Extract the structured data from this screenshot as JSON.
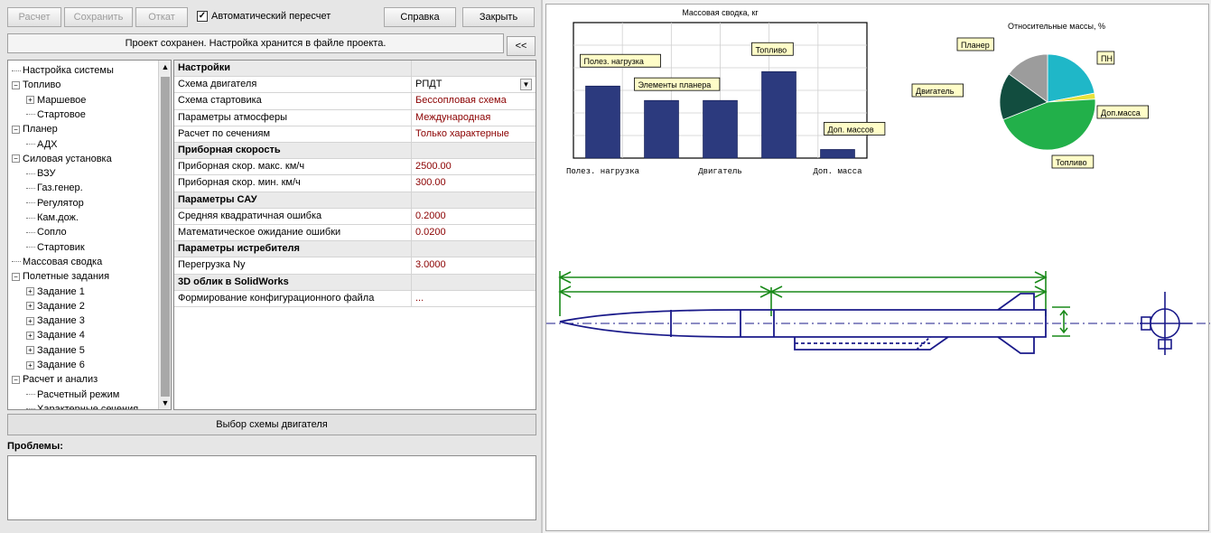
{
  "toolbar": {
    "calc": "Расчет",
    "save": "Сохранить",
    "rollback": "Откат",
    "auto_recalc": "Автоматический пересчет",
    "help": "Справка",
    "close": "Закрыть"
  },
  "status": "Проект сохранен. Настройка хранится в файле проекта.",
  "collapse": "<<",
  "tree": [
    {
      "label": "Настройка системы",
      "level": 0,
      "exp": ""
    },
    {
      "label": "Топливо",
      "level": 0,
      "exp": "−"
    },
    {
      "label": "Маршевое",
      "level": 1,
      "exp": "+"
    },
    {
      "label": "Стартовое",
      "level": 1,
      "exp": ""
    },
    {
      "label": "Планер",
      "level": 0,
      "exp": "−"
    },
    {
      "label": "АДХ",
      "level": 1,
      "exp": ""
    },
    {
      "label": "Силовая установка",
      "level": 0,
      "exp": "−"
    },
    {
      "label": "ВЗУ",
      "level": 1,
      "exp": ""
    },
    {
      "label": "Газ.генер.",
      "level": 1,
      "exp": ""
    },
    {
      "label": "Регулятор",
      "level": 1,
      "exp": ""
    },
    {
      "label": "Кам.дож.",
      "level": 1,
      "exp": ""
    },
    {
      "label": "Сопло",
      "level": 1,
      "exp": ""
    },
    {
      "label": "Стартовик",
      "level": 1,
      "exp": ""
    },
    {
      "label": "Массовая сводка",
      "level": 0,
      "exp": ""
    },
    {
      "label": "Полетные задания",
      "level": 0,
      "exp": "−"
    },
    {
      "label": "Задание 1",
      "level": 1,
      "exp": "+"
    },
    {
      "label": "Задание 2",
      "level": 1,
      "exp": "+"
    },
    {
      "label": "Задание 3",
      "level": 1,
      "exp": "+"
    },
    {
      "label": "Задание 4",
      "level": 1,
      "exp": "+"
    },
    {
      "label": "Задание 5",
      "level": 1,
      "exp": "+"
    },
    {
      "label": "Задание 6",
      "level": 1,
      "exp": "+"
    },
    {
      "label": "Расчет и анализ",
      "level": 0,
      "exp": "−"
    },
    {
      "label": "Расчетный режим",
      "level": 1,
      "exp": ""
    },
    {
      "label": "Характерные сечения",
      "level": 1,
      "exp": ""
    }
  ],
  "grid": [
    {
      "key": "Настройки",
      "value": "",
      "section": true
    },
    {
      "key": "Схема двигателя",
      "value": "РПДТ",
      "dropdown": true
    },
    {
      "key": "Схема стартовика",
      "value": "Бессопловая схема"
    },
    {
      "key": "Параметры атмосферы",
      "value": "Международная"
    },
    {
      "key": "Расчет по сечениям",
      "value": "Только характерные"
    },
    {
      "key": "Приборная скорость",
      "value": "",
      "section": true
    },
    {
      "key": "Приборная скор. макс. км/ч",
      "value": "2500.00"
    },
    {
      "key": "Приборная скор. мин. км/ч",
      "value": "300.00"
    },
    {
      "key": "Параметры САУ",
      "value": "",
      "section": true
    },
    {
      "key": "Средняя квадратичная ошибка",
      "value": "0.2000"
    },
    {
      "key": "Математическое ожидание ошибки",
      "value": "0.0200"
    },
    {
      "key": "Параметры истребителя",
      "value": "",
      "section": true
    },
    {
      "key": "Перегрузка Ny",
      "value": "3.0000"
    },
    {
      "key": "3D облик в SolidWorks",
      "value": "",
      "section": true
    },
    {
      "key": "Формирование конфигурационного файла",
      "value": "..."
    }
  ],
  "select_engine": "Выбор схемы двигателя",
  "problems_label": "Проблемы:",
  "colors": {
    "bar": "#2c3a7e",
    "drawing": "#1a1a8a",
    "dimension": "#1a8a1a",
    "pie": [
      "#1fb7c8",
      "#e8e23a",
      "#22b04a",
      "#124d3f",
      "#9c9c9c"
    ]
  },
  "chart_data": [
    {
      "type": "bar",
      "title": "Массовая сводка, кг",
      "categories": [
        "Полез. нагрузка",
        "Элементы планера",
        "Двигатель",
        "Топливо",
        "Доп. массов"
      ],
      "xtick_labels": [
        "Полез. нагрузка",
        "Двигатель",
        "Доп. масса"
      ],
      "values": [
        2.5,
        2.0,
        2.0,
        3.0,
        0.3
      ],
      "ylim": [
        0,
        4.7
      ],
      "grid": true
    },
    {
      "type": "pie",
      "title": "Относительные массы, %",
      "labels": [
        "ПН",
        "Доп.масса",
        "Топливо",
        "Двигатель",
        "Планер"
      ],
      "values": [
        22,
        2,
        45,
        16,
        15
      ]
    }
  ]
}
